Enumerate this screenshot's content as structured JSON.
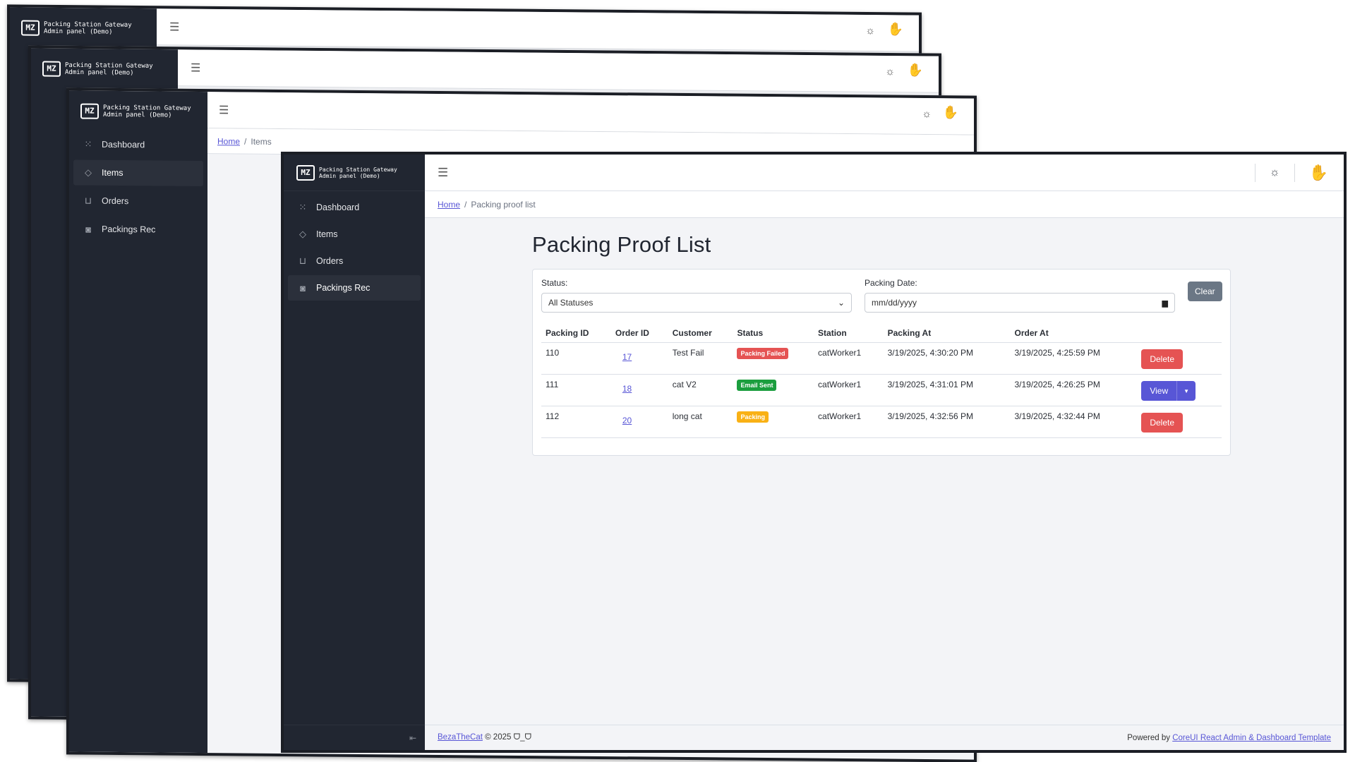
{
  "brand": {
    "line1": "Packing Station Gateway",
    "line2": "Admin panel (Demo)",
    "logo_text": "MZ"
  },
  "nav": [
    {
      "label": "Dashboard",
      "icon": "grid-icon"
    },
    {
      "label": "Items",
      "icon": "diamond-icon"
    },
    {
      "label": "Orders",
      "icon": "cart-icon"
    },
    {
      "label": "Packings Rec",
      "icon": "camera-icon"
    }
  ],
  "bg_breadcrumb": {
    "home": "Home",
    "current": "Items"
  },
  "icons": {
    "menu": "☰",
    "theme": "☼",
    "avatar": "✋",
    "collapse": "⇤"
  },
  "breadcrumb": {
    "home": "Home",
    "current": "Packing proof list"
  },
  "page": {
    "title": "Packing Proof List"
  },
  "filters": {
    "status_label": "Status:",
    "status_value": "All Statuses",
    "date_label": "Packing Date:",
    "date_placeholder": "mm/dd/yyyy",
    "clear_label": "Clear"
  },
  "table": {
    "headers": [
      "Packing ID",
      "Order ID",
      "Customer",
      "Status",
      "Station",
      "Packing At",
      "Order At"
    ],
    "rows": [
      {
        "packing_id": "110",
        "order_id": "17",
        "customer": "Test Fail",
        "status": "Packing Failed",
        "station": "catWorker1",
        "packing_at": "3/19/2025, 4:30:20 PM",
        "order_at": "3/19/2025, 4:25:59 PM",
        "action": "Delete"
      },
      {
        "packing_id": "111",
        "order_id": "18",
        "customer": "cat V2",
        "status": "Email Sent",
        "station": "catWorker1",
        "packing_at": "3/19/2025, 4:31:01 PM",
        "order_at": "3/19/2025, 4:26:25 PM",
        "action": "View"
      },
      {
        "packing_id": "112",
        "order_id": "20",
        "customer": "long cat",
        "status": "Packing",
        "station": "catWorker1",
        "packing_at": "3/19/2025, 4:32:56 PM",
        "order_at": "3/19/2025, 4:32:44 PM",
        "action": "Delete"
      }
    ]
  },
  "colors": {
    "failed": "#e55353",
    "sent": "#1b9e3e",
    "packing": "#f9b115",
    "primary": "#5856d6",
    "sidebar": "#212631"
  },
  "footer": {
    "author": "BezaTheCat",
    "copyright": "© 2025 ᗜ_ᗜ",
    "powered_prefix": "Powered by",
    "powered_link": "CoreUI React Admin & Dashboard Template"
  }
}
